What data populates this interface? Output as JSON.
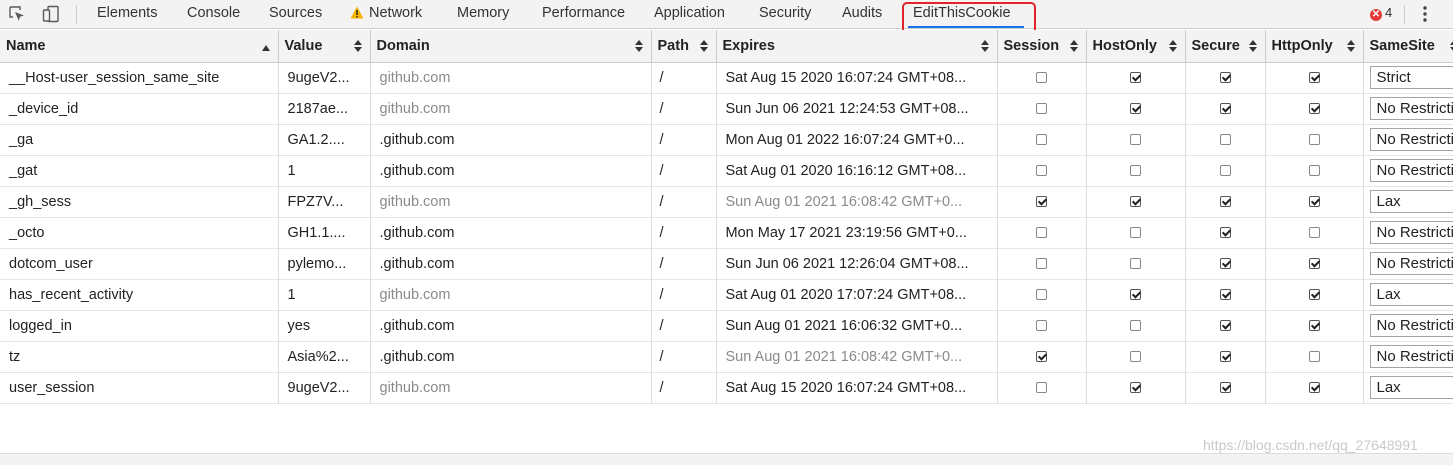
{
  "toolbar": {
    "tabs": [
      {
        "label": "Elements"
      },
      {
        "label": "Console"
      },
      {
        "label": "Sources"
      },
      {
        "label": "Network",
        "warning": true
      },
      {
        "label": "Memory"
      },
      {
        "label": "Performance"
      },
      {
        "label": "Application"
      },
      {
        "label": "Security"
      },
      {
        "label": "Audits"
      },
      {
        "label": "EditThisCookie",
        "active": true
      }
    ],
    "error_count": "4"
  },
  "table": {
    "columns": [
      "Name",
      "Value",
      "Domain",
      "Path",
      "Expires",
      "Session",
      "HostOnly",
      "Secure",
      "HttpOnly",
      "SameSite"
    ],
    "rows": [
      {
        "name": "__Host-user_session_same_site",
        "value": "9ugeV2...",
        "domain": "github.com",
        "path": "/",
        "expires": "Sat Aug 15 2020 16:07:24 GMT+08...",
        "session": false,
        "hostonly": true,
        "secure": true,
        "httponly": true,
        "samesite": "Strict"
      },
      {
        "name": "_device_id",
        "value": "2187ae...",
        "domain": "github.com",
        "path": "/",
        "expires": "Sun Jun 06 2021 12:24:53 GMT+08...",
        "session": false,
        "hostonly": true,
        "secure": true,
        "httponly": true,
        "samesite": "No Restriction"
      },
      {
        "name": "_ga",
        "value": "GA1.2....",
        "domain": ".github.com",
        "path": "/",
        "expires": "Mon Aug 01 2022 16:07:24 GMT+0...",
        "session": false,
        "hostonly": false,
        "secure": false,
        "httponly": false,
        "samesite": "No Restriction"
      },
      {
        "name": "_gat",
        "value": "1",
        "domain": ".github.com",
        "path": "/",
        "expires": "Sat Aug 01 2020 16:16:12 GMT+08...",
        "session": false,
        "hostonly": false,
        "secure": false,
        "httponly": false,
        "samesite": "No Restriction"
      },
      {
        "name": "_gh_sess",
        "value": "FPZ7V...",
        "domain": "github.com",
        "path": "/",
        "expires": "Sun Aug 01 2021 16:08:42 GMT+0...",
        "session": true,
        "hostonly": true,
        "secure": true,
        "httponly": true,
        "samesite": "Lax"
      },
      {
        "name": "_octo",
        "value": "GH1.1....",
        "domain": ".github.com",
        "path": "/",
        "expires": "Mon May 17 2021 23:19:56 GMT+0...",
        "session": false,
        "hostonly": false,
        "secure": true,
        "httponly": false,
        "samesite": "No Restriction"
      },
      {
        "name": "dotcom_user",
        "value": "pylemo...",
        "domain": ".github.com",
        "path": "/",
        "expires": "Sun Jun 06 2021 12:26:04 GMT+08...",
        "session": false,
        "hostonly": false,
        "secure": true,
        "httponly": true,
        "samesite": "No Restriction"
      },
      {
        "name": "has_recent_activity",
        "value": "1",
        "domain": "github.com",
        "path": "/",
        "expires": "Sat Aug 01 2020 17:07:24 GMT+08...",
        "session": false,
        "hostonly": true,
        "secure": true,
        "httponly": true,
        "samesite": "Lax"
      },
      {
        "name": "logged_in",
        "value": "yes",
        "domain": ".github.com",
        "path": "/",
        "expires": "Sun Aug 01 2021 16:06:32 GMT+0...",
        "session": false,
        "hostonly": false,
        "secure": true,
        "httponly": true,
        "samesite": "No Restriction"
      },
      {
        "name": "tz",
        "value": "Asia%2...",
        "domain": ".github.com",
        "path": "/",
        "expires": "Sun Aug 01 2021 16:08:42 GMT+0...",
        "session": true,
        "hostonly": false,
        "secure": true,
        "httponly": false,
        "samesite": "No Restriction"
      },
      {
        "name": "user_session",
        "value": "9ugeV2...",
        "domain": "github.com",
        "path": "/",
        "expires": "Sat Aug 15 2020 16:07:24 GMT+08...",
        "session": false,
        "hostonly": true,
        "secure": true,
        "httponly": true,
        "samesite": "Lax"
      }
    ]
  },
  "watermark": "https://blog.csdn.net/qq_27648991"
}
